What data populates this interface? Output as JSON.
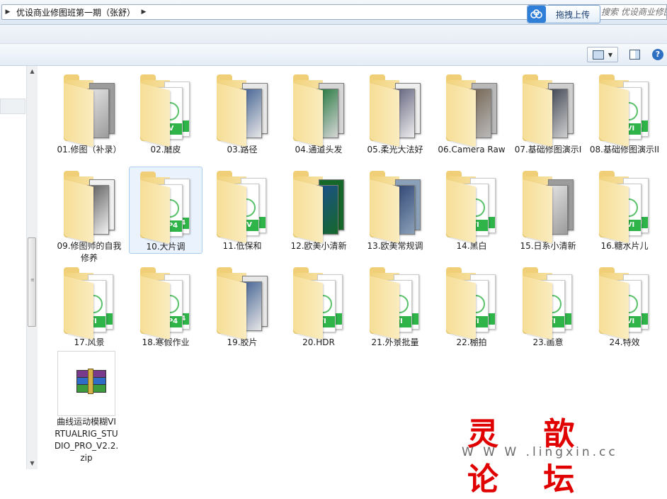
{
  "address": {
    "segments": [
      "优设商业修图班第一期（张舒）"
    ],
    "search_placeholder": "搜索 优设商业修图班..."
  },
  "upload": {
    "label": "拖拽上传"
  },
  "items": [
    {
      "label": "01.修图（补录）",
      "kind": "slides"
    },
    {
      "label": "02.磨皮",
      "kind": "video",
      "badge": "LV"
    },
    {
      "label": "03.路径",
      "kind": "photo"
    },
    {
      "label": "04.通道头发",
      "kind": "screen"
    },
    {
      "label": "05.柔光大法好",
      "kind": "screen"
    },
    {
      "label": "06.Camera Raw",
      "kind": "screen"
    },
    {
      "label": "07.基础修图演示I",
      "kind": "screen"
    },
    {
      "label": "08.基础修图演示II",
      "kind": "video",
      "badge": "AVI"
    },
    {
      "label": "09.修图师的自我修养",
      "kind": "screen"
    },
    {
      "label": "10.大片调",
      "kind": "video",
      "badge": "MP4"
    },
    {
      "label": "11.低保和",
      "kind": "video",
      "badge": "MV"
    },
    {
      "label": "12.欧美小清新",
      "kind": "screen"
    },
    {
      "label": "13.欧美常规调",
      "kind": "screen"
    },
    {
      "label": "14.黑白",
      "kind": "video",
      "badge": "VI"
    },
    {
      "label": "15.日系小清新",
      "kind": "screen"
    },
    {
      "label": "16.糖水片儿",
      "kind": "video",
      "badge": "AVI"
    },
    {
      "label": "17.风景",
      "kind": "video",
      "badge": "VI"
    },
    {
      "label": "18.寒假作业",
      "kind": "video",
      "badge": "MP4"
    },
    {
      "label": "19.胶片",
      "kind": "screen"
    },
    {
      "label": "20.HDR",
      "kind": "video",
      "badge": "VI"
    },
    {
      "label": "21.外景批量",
      "kind": "video",
      "badge": "VI"
    },
    {
      "label": "22.棚拍",
      "kind": "video",
      "badge": "VI"
    },
    {
      "label": "23.画意",
      "kind": "video",
      "badge": "VI"
    },
    {
      "label": "24.特效",
      "kind": "video",
      "badge": "AVI"
    }
  ],
  "zip": {
    "label": "曲线运动模糊VIRTUALRIG_STUDIO_PRO_V2.2.zip"
  },
  "watermark": {
    "text": "灵 歆 论 坛",
    "url": "W W W .lingxin.cc"
  },
  "colors": {
    "folder": "#f6de96",
    "video_badge": "#2fb44a",
    "selection": "#eaf3fd",
    "watermark": "#e00000"
  }
}
